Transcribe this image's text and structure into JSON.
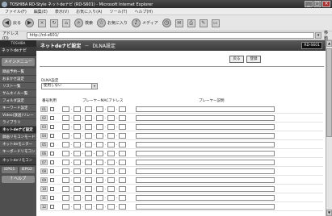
{
  "window": {
    "title": "TOSHIBA RD-Style ネットdeナビ (RD-S601) - Microsoft Internet Explorer"
  },
  "menubar": [
    "ファイル(F)",
    "編集(E)",
    "表示(V)",
    "お気に入り(A)",
    "ツール(T)",
    "ヘルプ(H)"
  ],
  "toolbar": {
    "back_label": "戻る",
    "search_label": "検索",
    "favorites_label": "お気に入り",
    "media_label": "メディア"
  },
  "address": {
    "label": "アドレス(D)",
    "url": "http://rd-s601/",
    "go_label": "移動"
  },
  "sidebar": {
    "logo": "TOSHIBA",
    "main_title": "ネットdeナビ",
    "menu_button": "メインメニュー",
    "items": [
      "録画予約一覧",
      "おまかせ設定",
      "リスト一覧",
      "サムネイル一覧",
      "フォルダ設定",
      "キーワード設定",
      "Video(放送)リレー",
      "ライブラリ",
      "ネットdeナビ設定",
      "録画リモコンモード",
      "ネットdeモニター",
      "キーボードリモコン"
    ],
    "section_label": "ネットdeリモコン",
    "eps": [
      "iEPG1",
      "iEPG2"
    ],
    "help_label": "? ヘルプ"
  },
  "header": {
    "title": "ネットdeナビ設定",
    "separator": "－",
    "subtitle": "DLNA設定",
    "model": "RD-S601"
  },
  "buttons": {
    "back": "戻る",
    "save": "登録"
  },
  "dlna": {
    "label": "DLNA設定",
    "selected": "使用しない"
  },
  "table": {
    "headers": {
      "number": "番号",
      "use": "利用",
      "mac": "プレーヤーMACアドレス",
      "description": "プレーヤー説明"
    },
    "rows": [
      "01",
      "02",
      "03",
      "04",
      "05",
      "06",
      "07",
      "08",
      "09",
      "10",
      "11",
      "12"
    ]
  }
}
